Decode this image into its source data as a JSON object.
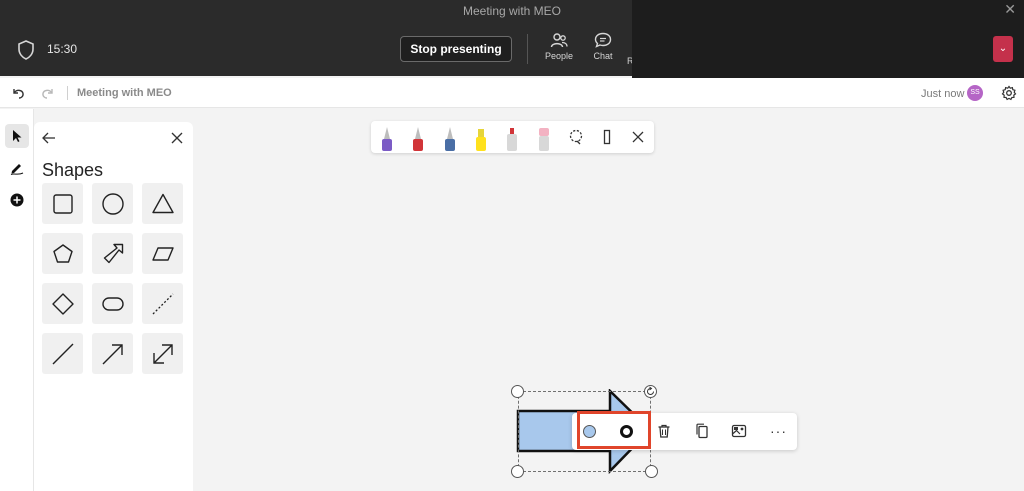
{
  "window": {
    "title": "Meeting with MEO",
    "close_glyph": "✕"
  },
  "meeting_bar": {
    "time": "15:30",
    "stop_presenting_label": "Stop presenting",
    "people_label": "People",
    "chat_label": "Chat",
    "more_label": "Raise",
    "leave_glyph": "⌄"
  },
  "whiteboard": {
    "title": "Meeting with MEO",
    "save_status": "Just now",
    "avatar_initials": "SS"
  },
  "shapes_panel": {
    "title": "Shapes",
    "shapes": [
      "square-icon",
      "circle-icon",
      "triangle-icon",
      "pentagon-icon",
      "arrow-shape-icon",
      "parallelogram-icon",
      "diamond-icon",
      "rounded-rectangle-icon",
      "dashed-line-icon",
      "line-icon",
      "arrow-line-icon",
      "double-arrow-icon"
    ]
  },
  "ink_toolbar": {
    "pens": [
      {
        "name": "purple-pen",
        "color": "#7b5bc5"
      },
      {
        "name": "red-pen",
        "color": "#d13438"
      },
      {
        "name": "blue-pen",
        "color": "#4a6ea5"
      },
      {
        "name": "yellow-highlighter",
        "color": "#ffe11d"
      },
      {
        "name": "eraser",
        "color": "#d8d8d8"
      },
      {
        "name": "pink-highlighter",
        "color": "#f3b2c2"
      }
    ]
  },
  "context_toolbar": {
    "fill_color": "#a8c8ec",
    "outline_color": "#111111",
    "more_label": "···"
  },
  "colors": {
    "accent": "#e0452b",
    "avatar": "#b565c6",
    "leave": "#c4314b"
  }
}
